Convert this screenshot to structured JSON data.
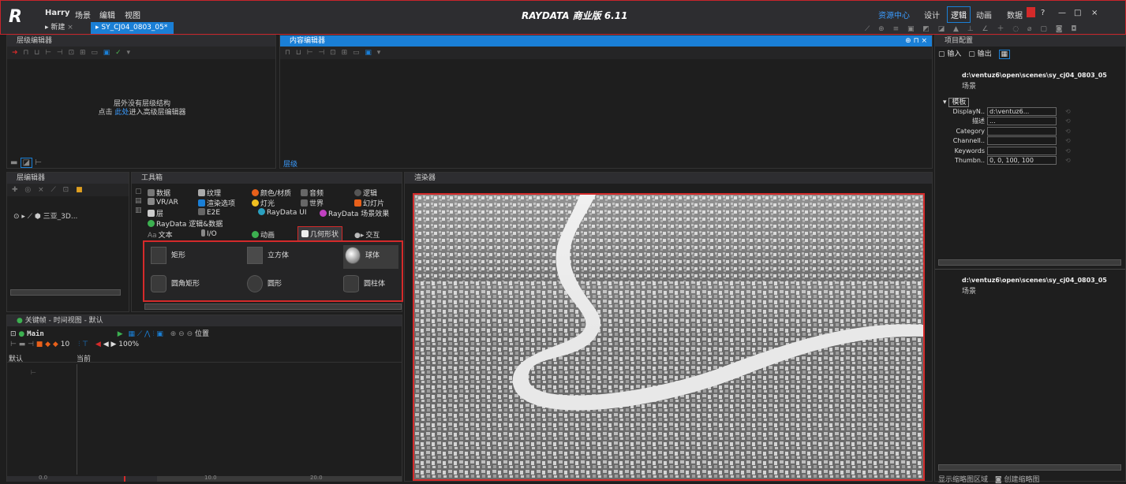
{
  "titlebar": {
    "user": "Harry",
    "menus": [
      "场景",
      "编辑",
      "视图"
    ],
    "tab_new": "新建",
    "tab_active": "SY_CJ04_0803_05*",
    "brand": "RAYDATA 商业版 6.11",
    "resource_center": "资源中心",
    "modes": [
      "设计",
      "逻辑",
      "动画",
      "数据"
    ],
    "window_controls": [
      "?",
      "—",
      "□",
      "×"
    ]
  },
  "hierarchy_editor": {
    "title": "层级编辑器",
    "msg_line1": "层外没有层级结构",
    "msg_line2_prefix": "点击 ",
    "msg_line2_link": "此处",
    "msg_line2_suffix": "进入高级层编辑器"
  },
  "content_editor": {
    "title": "内容编辑器",
    "footer": "层级"
  },
  "project_config": {
    "title": "项目配置",
    "import": "输入",
    "export": "输出",
    "path": "d:\\ventuz6\\open\\scenes\\sy_cj04_0803_05",
    "scene": "场景",
    "group": "模板",
    "props": [
      {
        "label": "DisplayN..",
        "value": "d:\\ventuz6..."
      },
      {
        "label": "描述",
        "value": "..."
      },
      {
        "label": "Category",
        "value": ""
      },
      {
        "label": "ChannelI..",
        "value": ""
      },
      {
        "label": "Keywords",
        "value": ""
      },
      {
        "label": "Thumbn..",
        "value": "0, 0, 100, 100"
      }
    ],
    "path2": "d:\\ventuz6\\open\\scenes\\sy_cj04_0803_05",
    "scene2": "场景",
    "bottom_left": "显示缩略图区域",
    "bottom_right": "创建缩略图"
  },
  "layer_editor": {
    "title": "层编辑器",
    "item": "三亚_3D..."
  },
  "toolbox": {
    "title": "工具箱",
    "categories": [
      [
        "数据",
        "纹理",
        "颜色/材质",
        "音频",
        "逻辑"
      ],
      [
        "VR/AR",
        "渲染选项",
        "灯光",
        "世界",
        "幻灯片"
      ],
      [
        "层",
        "E2E",
        "RayData UI",
        "RayData 场景效果"
      ],
      [
        "RayData 逻辑&数据"
      ],
      [
        "文本",
        "I/O",
        "动画",
        "几何形状",
        "交互"
      ]
    ],
    "shapes": [
      "矩形",
      "立方体",
      "球体",
      "圆角矩形",
      "圆形",
      "圆柱体"
    ]
  },
  "timeline": {
    "title": "关键帧 - 时间视图 - 默认",
    "track": "Main",
    "position": "位置",
    "number": "10",
    "zoom": "100%",
    "col_default": "默认",
    "col_current": "当前",
    "ticks": [
      "0.0",
      "10.0",
      "20.0"
    ]
  },
  "renderer": {
    "title": "渲染器"
  },
  "colors": {
    "accent": "#1a7fd6",
    "highlight_border": "#d42a2a",
    "river": "#e8e8e8"
  }
}
